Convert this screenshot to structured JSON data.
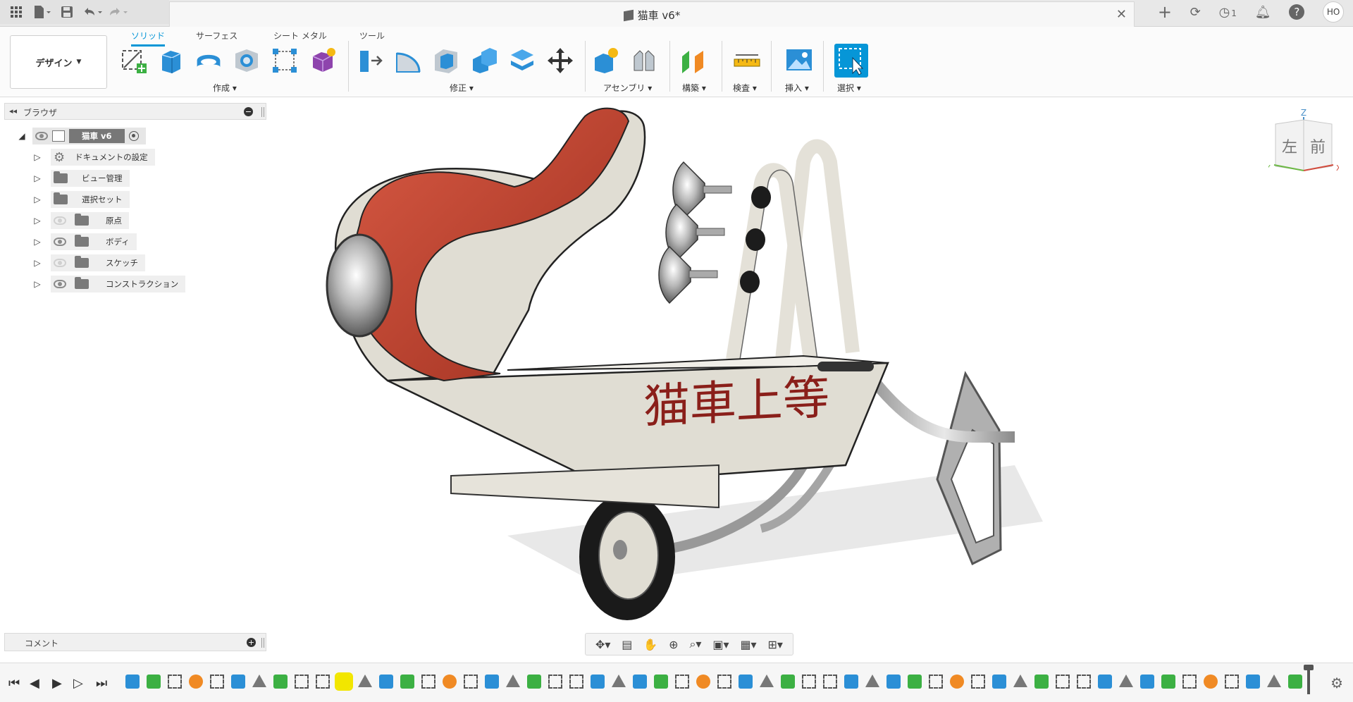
{
  "titlebar": {
    "document_title": "猫車 v6*",
    "job_count": "1",
    "user_initials": "HO"
  },
  "ribbon": {
    "workspace": "デザイン",
    "tabs": [
      {
        "label": "ソリッド",
        "active": true
      },
      {
        "label": "サーフェス",
        "active": false
      },
      {
        "label": "シート メタル",
        "active": false
      },
      {
        "label": "ツール",
        "active": false
      }
    ],
    "groups": {
      "create": "作成",
      "modify": "修正",
      "assemble": "アセンブリ",
      "construct": "構築",
      "inspect": "検査",
      "insert": "挿入",
      "select": "選択"
    },
    "accent_color": "#0696d7"
  },
  "browser": {
    "title": "ブラウザ",
    "root": "猫車 v6",
    "items": [
      {
        "label": "ドキュメントの設定",
        "icon": "gear-icon",
        "visible": null
      },
      {
        "label": "ビュー管理",
        "icon": "folder-icon",
        "visible": null
      },
      {
        "label": "選択セット",
        "icon": "folder-icon",
        "visible": null
      },
      {
        "label": "原点",
        "icon": "folder-icon",
        "visible": false
      },
      {
        "label": "ボディ",
        "icon": "folder-icon",
        "visible": true
      },
      {
        "label": "スケッチ",
        "icon": "folder-icon",
        "visible": false
      },
      {
        "label": "コンストラクション",
        "icon": "folder-icon",
        "visible": true
      }
    ]
  },
  "comments": {
    "title": "コメント"
  },
  "viewcube": {
    "left_face": "左",
    "front_face": "前",
    "axis_z": "Z",
    "axis_x": "X",
    "axis_y": "Y"
  },
  "model": {
    "side_text": "猫車上等",
    "body_color": "#e0ddd3",
    "stripe_color": "#c0432f"
  }
}
